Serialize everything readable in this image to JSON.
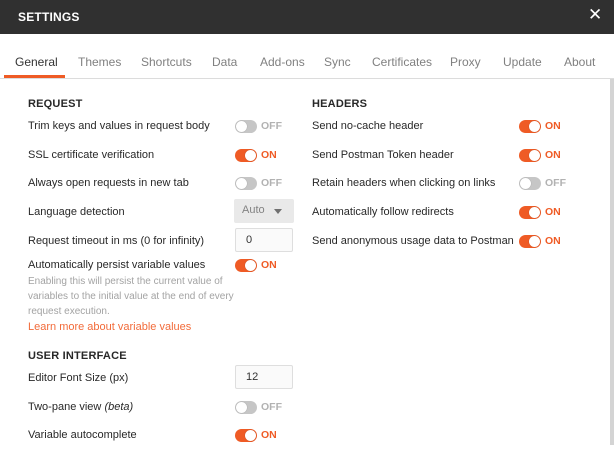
{
  "window": {
    "title": "SETTINGS",
    "close_icon": "close-icon"
  },
  "tabs": [
    {
      "label": "General",
      "active": true
    },
    {
      "label": "Themes"
    },
    {
      "label": "Shortcuts"
    },
    {
      "label": "Data"
    },
    {
      "label": "Add-ons"
    },
    {
      "label": "Sync"
    },
    {
      "label": "Certificates"
    },
    {
      "label": "Proxy"
    },
    {
      "label": "Update"
    },
    {
      "label": "About"
    }
  ],
  "accent_color": "#ef5b25",
  "request": {
    "heading": "REQUEST",
    "trim_keys": {
      "label": "Trim keys and values in request body",
      "state": "OFF"
    },
    "ssl_verification": {
      "label": "SSL certificate verification",
      "state": "ON"
    },
    "open_new_tab": {
      "label": "Always open requests in new tab",
      "state": "OFF"
    },
    "language_detection": {
      "label": "Language detection",
      "value": "Auto"
    },
    "timeout": {
      "label": "Request timeout in ms (0 for infinity)",
      "value": "0"
    },
    "persist_variables": {
      "label": "Automatically persist variable values",
      "state": "ON",
      "help": "Enabling this will persist the current value of variables to the initial value at the end of every request execution.",
      "link": "Learn more about variable values"
    }
  },
  "user_interface": {
    "heading": "USER INTERFACE",
    "editor_font_size": {
      "label": "Editor Font Size (px)",
      "value": "12"
    },
    "two_pane": {
      "label": "Two-pane view",
      "label_beta": "(beta)",
      "state": "OFF"
    },
    "variable_autocomplete": {
      "label": "Variable autocomplete",
      "state": "ON"
    }
  },
  "headers": {
    "heading": "HEADERS",
    "no_cache": {
      "label": "Send no-cache header",
      "state": "ON"
    },
    "postman_token": {
      "label": "Send Postman Token header",
      "state": "ON"
    },
    "retain_headers": {
      "label": "Retain headers when clicking on links",
      "state": "OFF"
    },
    "follow_redirects": {
      "label": "Automatically follow redirects",
      "state": "ON"
    },
    "anonymous_usage": {
      "label": "Send anonymous usage data to Postman",
      "state": "ON"
    }
  }
}
